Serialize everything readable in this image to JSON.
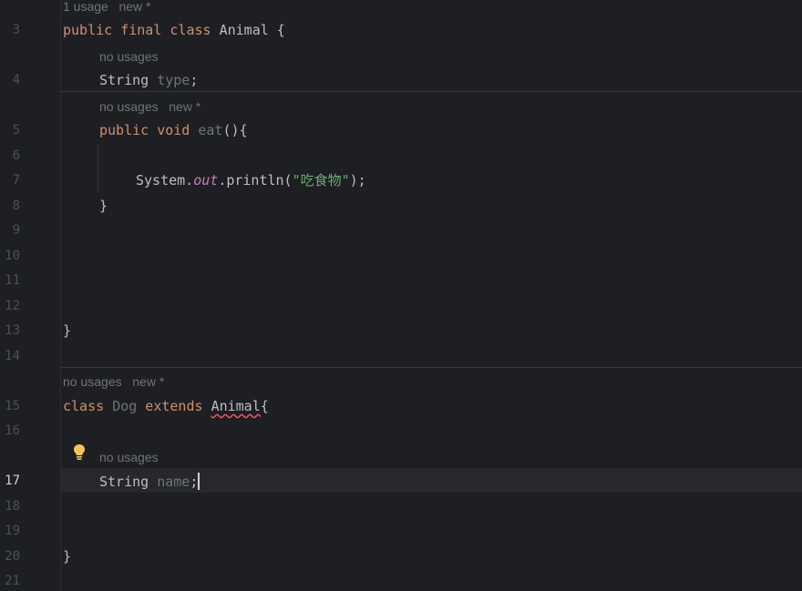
{
  "editor": {
    "line_numbers": [
      "3",
      "4",
      "5",
      "6",
      "7",
      "8",
      "9",
      "10",
      "11",
      "12",
      "13",
      "14",
      "15",
      "16",
      "17",
      "18",
      "19",
      "20",
      "21"
    ],
    "current_line": "17",
    "hints": {
      "class_animal": "1 usage   new *",
      "field_type": "no usages",
      "method_eat": "no usages   new *",
      "class_dog": "no usages   new *",
      "field_name": "no usages"
    },
    "code": {
      "l3_kw": "public final class",
      "l3_name": " Animal {",
      "l4_type": "String ",
      "l4_field": "type",
      "l4_end": ";",
      "l5_kw": "public void ",
      "l5_method": "eat",
      "l5_end": "(){",
      "l7_a": "System.",
      "l7_static": "out",
      "l7_b": ".println(",
      "l7_str": "\"吃食物\"",
      "l7_c": ");",
      "l8": "}",
      "l13": "}",
      "l15_kw1": "class ",
      "l15_name": "Dog",
      "l15_kw2": " extends ",
      "l15_super": "Animal",
      "l15_brace": "{",
      "l17_type": "String ",
      "l17_field": "name",
      "l17_end": ";",
      "l20": "}"
    },
    "icons": {
      "intention": "lightbulb-icon"
    },
    "colors": {
      "background": "#1e1f22",
      "keyword": "#cf8e6d",
      "string": "#6aab73",
      "static_field": "#c77dbb",
      "unused": "#6f737a",
      "error_underline": "#f75464",
      "bulb": "#f2c55c"
    }
  }
}
